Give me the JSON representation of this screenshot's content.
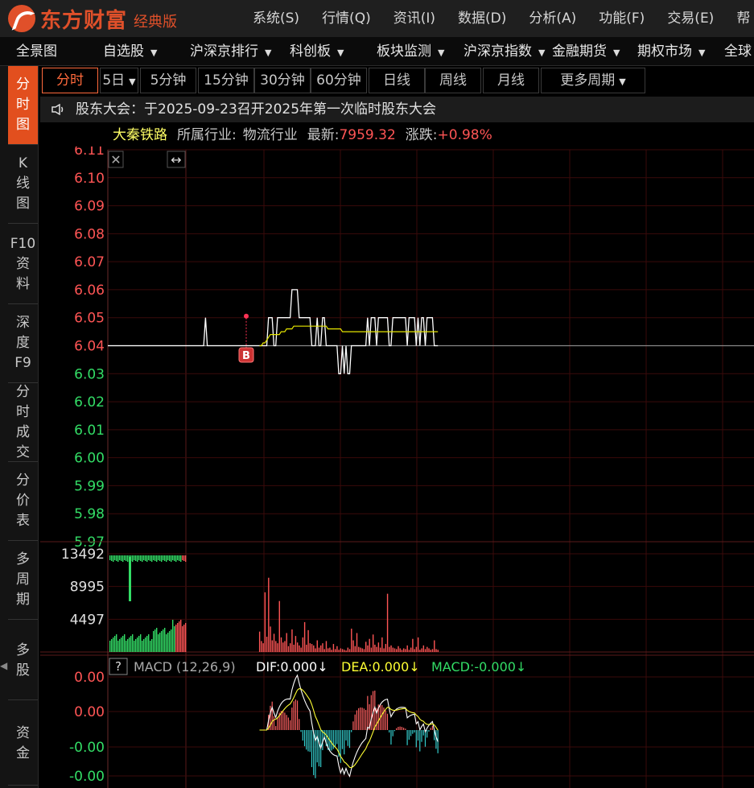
{
  "app": {
    "logo_name": "东方财富",
    "edition": "经典版",
    "menu": [
      "系统(S)",
      "行情(Q)",
      "资讯(I)",
      "数据(D)",
      "分析(A)",
      "功能(F)",
      "交易(E)",
      "帮"
    ]
  },
  "navbar": {
    "items": [
      {
        "label": "全景图",
        "dropdown": false
      },
      {
        "label": "自选股",
        "dropdown": true
      },
      {
        "label": "沪深京排行",
        "dropdown": true
      },
      {
        "label": "科创板",
        "dropdown": true
      },
      {
        "label": "板块监测",
        "dropdown": true
      },
      {
        "label": "沪深京指数",
        "dropdown": true
      },
      {
        "label": "金融期货",
        "dropdown": true
      },
      {
        "label": "期权市场",
        "dropdown": true
      },
      {
        "label": "全球",
        "dropdown": false
      }
    ]
  },
  "sidetabs": [
    {
      "label": "分\n时\n图",
      "active": true
    },
    {
      "label": "K\n线\n图",
      "active": false
    },
    {
      "label": "F10\n资\n料",
      "active": false
    },
    {
      "label": "深\n度\nF9",
      "active": false
    },
    {
      "label": "分\n时\n成\n交",
      "active": false
    },
    {
      "label": "分\n价\n表",
      "active": false
    },
    {
      "label": "多\n周\n期",
      "active": false
    },
    {
      "label": "多\n股",
      "active": false
    },
    {
      "label": "资\n金",
      "active": false
    }
  ],
  "periods": [
    {
      "label": "分时",
      "active": true
    },
    {
      "label": "5日",
      "dropdown": true
    },
    {
      "label": "5分钟"
    },
    {
      "label": "15分钟"
    },
    {
      "label": "30分钟"
    },
    {
      "label": "60分钟"
    },
    {
      "label": "日线"
    },
    {
      "label": "周线"
    },
    {
      "label": "月线"
    },
    {
      "label": "更多周期",
      "dropdown": true
    }
  ],
  "notice": "股东大会：于2025-09-23召开2025年第一次临时股东大会",
  "stock": {
    "name": "大秦铁路",
    "industry_label": "所属行业:",
    "industry": "物流行业",
    "latest_label": "最新:",
    "latest": "7959.32",
    "change_label": "涨跌:",
    "change": "+0.98%"
  },
  "colors": {
    "up": "#ff5555",
    "down": "#33dd66",
    "price_line": "#ffffff",
    "avg_line": "#e6e600",
    "grid": "#3a0000",
    "accent": "#e24f1e",
    "dif": "#ffffff",
    "dea": "#ffff33",
    "macd_label": "#33dd66"
  },
  "chart_data": {
    "type": "line",
    "price_ticks": [
      "6.11",
      "6.10",
      "6.09",
      "6.08",
      "6.07",
      "6.06",
      "6.05",
      "6.04",
      "6.03",
      "6.02",
      "6.01",
      "6.00",
      "5.99",
      "5.98",
      "5.97"
    ],
    "price_range": [
      5.97,
      6.11
    ],
    "base_price": 6.04,
    "marker": "B",
    "minutes": 240,
    "price": [
      6.04,
      6.04,
      6.04,
      6.04,
      6.04,
      6.04,
      6.04,
      6.04,
      6.04,
      6.04,
      6.05,
      6.04,
      6.04,
      6.04,
      6.04,
      6.04,
      6.04,
      6.04,
      6.04,
      6.04,
      6.04,
      6.04,
      6.04,
      6.04,
      6.04,
      6.04,
      6.04,
      6.04,
      6.04,
      6.04,
      6.04,
      6.04,
      6.04,
      6.04,
      6.04,
      6.04,
      6.04,
      6.04,
      6.04,
      6.04,
      6.04,
      6.04,
      6.04,
      6.04,
      6.04,
      6.05,
      6.05,
      6.05,
      6.04,
      6.04,
      6.05,
      6.05,
      6.05,
      6.05,
      6.05,
      6.05,
      6.05,
      6.05,
      6.06,
      6.06,
      6.06,
      6.06,
      6.05,
      6.05,
      6.05,
      6.05,
      6.05,
      6.05,
      6.05,
      6.04,
      6.04,
      6.04,
      6.05,
      6.04,
      6.04,
      6.05,
      6.05,
      6.04,
      6.04,
      6.04,
      6.04,
      6.04,
      6.04,
      6.04,
      6.03,
      6.03,
      6.04,
      6.03,
      6.04,
      6.03,
      6.03,
      6.04,
      6.04,
      6.04,
      6.04,
      6.04,
      6.04,
      6.04,
      6.04,
      6.04,
      6.05,
      6.04,
      6.05,
      6.05,
      6.05,
      6.04,
      6.05,
      6.05,
      6.05,
      6.05,
      6.05,
      6.05,
      6.04,
      6.04,
      6.05,
      6.05,
      6.05,
      6.05,
      6.05,
      6.05,
      6.05,
      6.05,
      6.04,
      6.05,
      6.05,
      6.05,
      6.05,
      6.04,
      6.05,
      6.04,
      6.05,
      6.05,
      6.04,
      6.05,
      6.05,
      6.05,
      6.05,
      6.04,
      6.04,
      6.04
    ],
    "avg": [
      6.04,
      6.04,
      6.04,
      6.04,
      6.04,
      6.04,
      6.04,
      6.04,
      6.04,
      6.04,
      6.041,
      6.041,
      6.041,
      6.041,
      6.041,
      6.041,
      6.041,
      6.041,
      6.041,
      6.041,
      6.041,
      6.041,
      6.041,
      6.041,
      6.041,
      6.041,
      6.041,
      6.041,
      6.041,
      6.041,
      6.041,
      6.041,
      6.041,
      6.041,
      6.041,
      6.041,
      6.041,
      6.041,
      6.041,
      6.041,
      6.04,
      6.04,
      6.041,
      6.041,
      6.042,
      6.043,
      6.044,
      6.044,
      6.044,
      6.044,
      6.044,
      6.044,
      6.045,
      6.045,
      6.045,
      6.046,
      6.046,
      6.046,
      6.046,
      6.047,
      6.047,
      6.047,
      6.047,
      6.047,
      6.047,
      6.047,
      6.047,
      6.047,
      6.047,
      6.047,
      6.047,
      6.047,
      6.047,
      6.047,
      6.047,
      6.047,
      6.047,
      6.047,
      6.046,
      6.046,
      6.046,
      6.046,
      6.046,
      6.046,
      6.046,
      6.046,
      6.045,
      6.045,
      6.045,
      6.045,
      6.045,
      6.045,
      6.045,
      6.045,
      6.045,
      6.045,
      6.045,
      6.045,
      6.045,
      6.045,
      6.045,
      6.045,
      6.045,
      6.045,
      6.045,
      6.045,
      6.045,
      6.045,
      6.045,
      6.045,
      6.045,
      6.045,
      6.045,
      6.045,
      6.045,
      6.045,
      6.045,
      6.045,
      6.045,
      6.045,
      6.045,
      6.045,
      6.045,
      6.045,
      6.045,
      6.045,
      6.045,
      6.045,
      6.045,
      6.045,
      6.045,
      6.045,
      6.045,
      6.045,
      6.045,
      6.045,
      6.045,
      6.045,
      6.045,
      6.045
    ],
    "volume_ticks": [
      "13492",
      "8995",
      "4497"
    ],
    "volume_max": 13492,
    "volume_up": [
      0,
      0,
      0,
      0,
      0,
      0,
      0,
      0,
      0,
      0,
      0,
      0,
      0,
      0,
      0,
      0,
      0,
      0,
      0,
      0,
      0,
      0,
      0,
      0,
      0,
      0,
      0,
      0,
      0,
      0,
      0,
      0,
      0,
      0,
      0,
      0,
      0,
      0,
      0,
      0,
      2800,
      1500,
      1200,
      8200,
      2100,
      10200,
      3500,
      1600,
      2500,
      1500,
      1200,
      7000,
      2000,
      1300,
      1500,
      2600,
      800,
      1200,
      3100,
      1000,
      2200,
      1300,
      900,
      600,
      2000,
      4100,
      1000,
      3000,
      1200,
      1100,
      900,
      500,
      1600,
      600,
      900,
      1200,
      400,
      1500,
      500,
      600,
      300,
      1100,
      400,
      800,
      300,
      500,
      400,
      300,
      200,
      600,
      400,
      3200,
      1600,
      800,
      2600,
      700,
      600,
      500,
      400,
      1400,
      900,
      1800,
      600,
      2400,
      1000,
      700,
      1300,
      600,
      2000,
      500,
      1100,
      8000,
      700,
      900,
      600,
      500,
      400,
      800,
      500,
      300,
      500,
      400,
      900,
      300,
      600,
      1800,
      400,
      700,
      2000,
      300,
      500,
      900,
      400,
      700,
      500,
      300,
      400,
      1600,
      400,
      300
    ],
    "volume_down": [
      0,
      0,
      0,
      0,
      0,
      0,
      0,
      0,
      0,
      0,
      0,
      0,
      0,
      0,
      0,
      0,
      0,
      0,
      0,
      0,
      0,
      0,
      0,
      0,
      0,
      0,
      0,
      0,
      0,
      0,
      0,
      0,
      0,
      0,
      0,
      0,
      0,
      0,
      0,
      0,
      0,
      0,
      0,
      0,
      0,
      0,
      0,
      0,
      0,
      0,
      0,
      0,
      0,
      0,
      0,
      0,
      0,
      0,
      0,
      0,
      0,
      0,
      0,
      0,
      0,
      0,
      0,
      0,
      0,
      0,
      0,
      0,
      0,
      0,
      0,
      0,
      0,
      0,
      0,
      0,
      0,
      0,
      0,
      0,
      0,
      0,
      0,
      0,
      0,
      0,
      0,
      0,
      0,
      0,
      0,
      0,
      0,
      0,
      0,
      0,
      0,
      0,
      0,
      0,
      0,
      0,
      0,
      0,
      0,
      0,
      0,
      0,
      0,
      0,
      0,
      0,
      0,
      0,
      0,
      0,
      0,
      0,
      0,
      0,
      0,
      0,
      0,
      0,
      0,
      0,
      0,
      0,
      0,
      0,
      0,
      0,
      0,
      0,
      0,
      0
    ],
    "macd_ticks": [
      "0.00",
      "0.00",
      "-0.00",
      "-0.00"
    ],
    "macd_title": "MACD (12,26,9)",
    "dif_label": "DIF:0.000↓",
    "dea_label": "DEA:0.000↓",
    "macd_label": "MACD:-0.000↓",
    "help_label": "?"
  }
}
